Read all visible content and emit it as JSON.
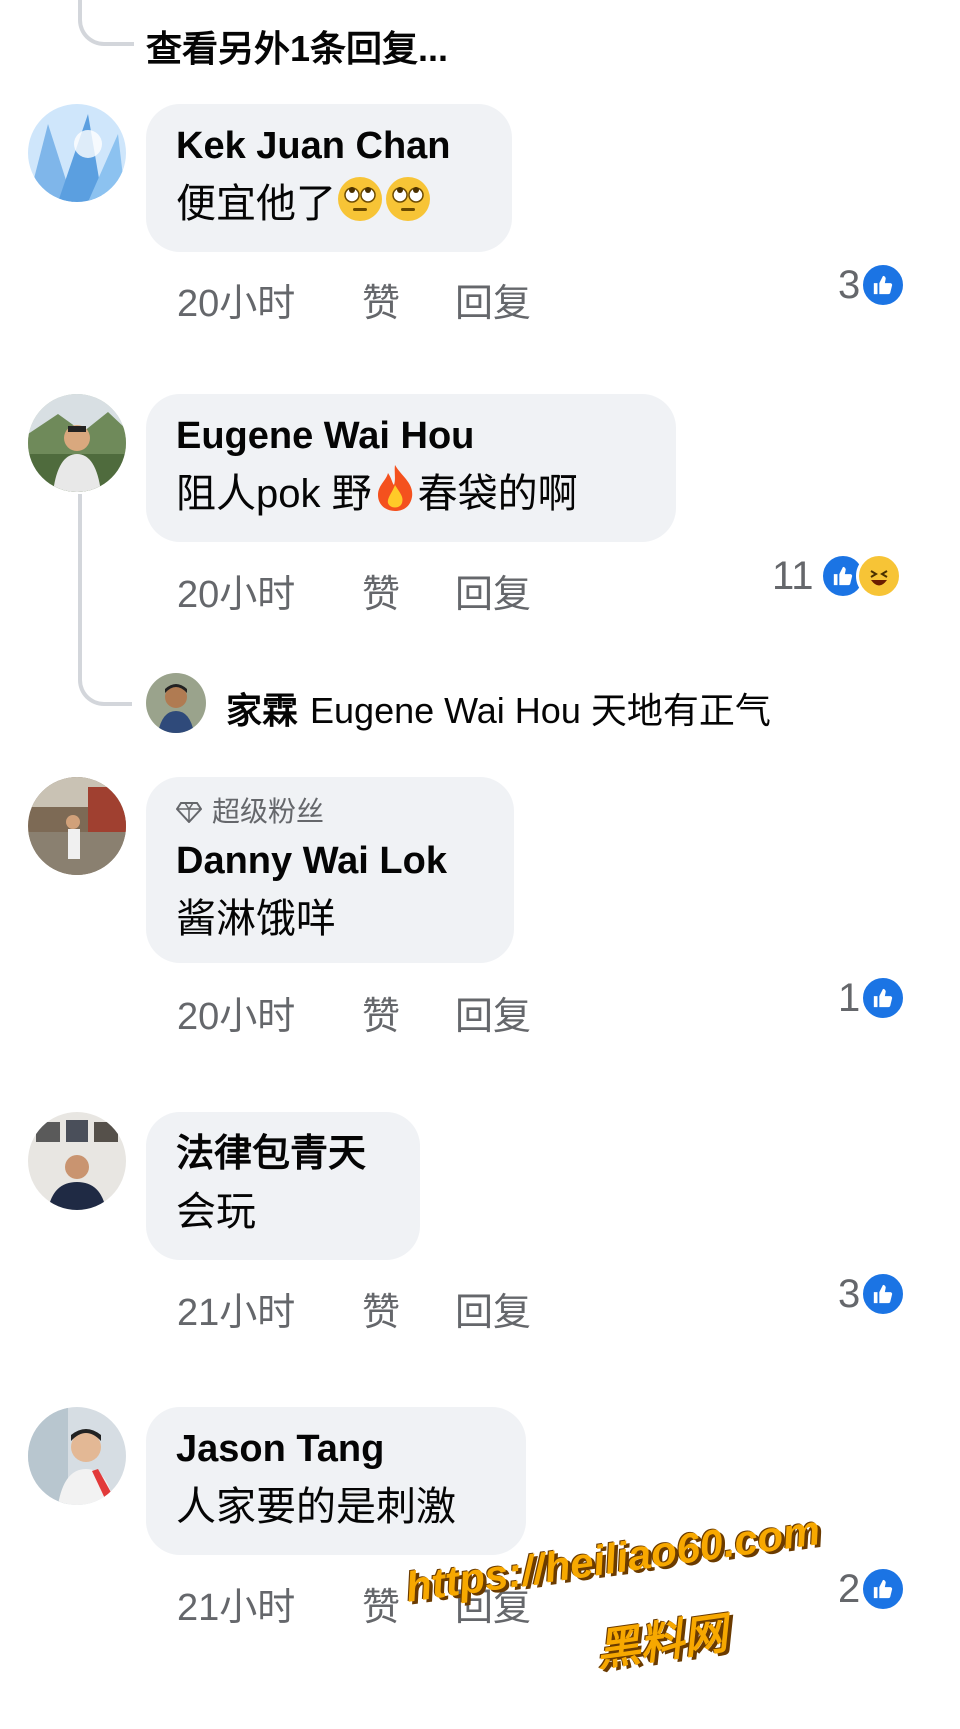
{
  "view_more": "查看另外1条回复...",
  "comments": [
    {
      "name": "Kek Juan Chan",
      "text": "便宜他了",
      "time": "20小时",
      "like": "赞",
      "reply": "回复",
      "count": "3"
    },
    {
      "name": "Eugene Wai Hou",
      "text_before": "阻人pok 野",
      "text_after": "春袋的啊",
      "time": "20小时",
      "like": "赞",
      "reply": "回复",
      "count": "11"
    },
    {
      "badge": "超级粉丝",
      "name": "Danny Wai Lok",
      "text": "酱淋饿咩",
      "time": "20小时",
      "like": "赞",
      "reply": "回复",
      "count": "1"
    },
    {
      "name": "法律包青天",
      "text": "会玩",
      "time": "21小时",
      "like": "赞",
      "reply": "回复",
      "count": "3"
    },
    {
      "name": "Jason Tang",
      "text": "人家要的是刺激",
      "time": "21小时",
      "like": "赞",
      "reply": "回复",
      "count": "2"
    }
  ],
  "nested_reply": {
    "name": "家霖",
    "text": "Eugene Wai Hou 天地有正气"
  },
  "watermark": {
    "url": "https://heiliao60.com",
    "site": "黑料网"
  },
  "colors": {
    "bubble": "#f0f2f5",
    "meta": "#65676b",
    "like": "#1b74e4",
    "watermark": "#f7a800"
  }
}
